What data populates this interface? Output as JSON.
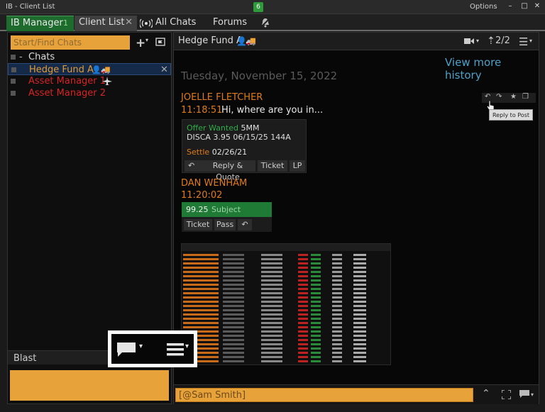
{
  "window": {
    "title": "IB - Client List",
    "badge": "6",
    "options_label": "Options",
    "btn_min": "–",
    "btn_max": "□",
    "btn_close": "✕"
  },
  "tabs": [
    {
      "label": "IB Manager",
      "count": "1"
    },
    {
      "label": "Client List",
      "close": "✕"
    },
    {
      "label": "All Chats",
      "icon": "broadcast-icon"
    },
    {
      "label": "Forums"
    }
  ],
  "sidebar": {
    "search_placeholder": "Start/Find Chats",
    "add_btn": "+",
    "add_caret": "▾",
    "group": {
      "toggle": "-",
      "label": "Chats"
    },
    "items": [
      {
        "label": "Hedge Fund A",
        "close": "✕"
      },
      {
        "label": "Asset Manager 1"
      },
      {
        "label": "Asset Manager 2"
      }
    ],
    "blast_label": "Blast"
  },
  "conversation": {
    "title": "Hedge Fund A",
    "page_indicator": "2/2",
    "history_link": "View more history",
    "date": "Tuesday, November 15, 2022",
    "tooltip": "Reply to Post",
    "messages": [
      {
        "sender": "JOELLE FLETCHER",
        "time": "11:18:51",
        "text": "Hi, where are you in..."
      },
      {
        "sender": "DAN WENHAM",
        "time": "11:20:02"
      }
    ],
    "quote_card": {
      "offer_label": "Offer Wanted",
      "offer_size": "5MM",
      "security": "DISCA 3.95 06/15/25 144A",
      "settle_label": "Settle",
      "settle_date": "02/26/21",
      "buttons": [
        "Reply & Quote",
        "Ticket",
        "LP"
      ]
    },
    "subject_card": {
      "price": "99.25",
      "status": "Subject",
      "buttons": [
        "Ticket",
        "Pass"
      ]
    },
    "compose_value": "[@Sam Smith]"
  },
  "colors": {
    "accent_orange": "#e8a23a",
    "sender_orange": "#e07b1a",
    "alert_red": "#d62424",
    "selection_blue": "#142a48",
    "tab_green": "#1e6b2e",
    "link_blue": "#4fa0c8"
  }
}
